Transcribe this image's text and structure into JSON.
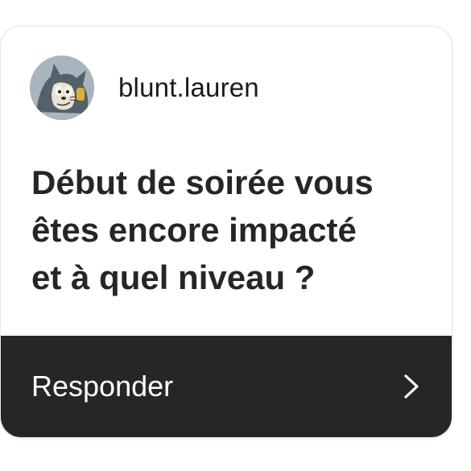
{
  "post": {
    "username": "blunt.lauren",
    "avatar_icon": "cartoon-cat-avatar-icon",
    "question_text": "Début de soirée vous\nêtes encore impacté\net à quel niveau ?"
  },
  "reply": {
    "label": "Responder",
    "icon": "chevron-right-icon"
  },
  "colors": {
    "reply_bar_background": "#262627",
    "question_text": "#262626",
    "card_background": "#ffffff"
  }
}
